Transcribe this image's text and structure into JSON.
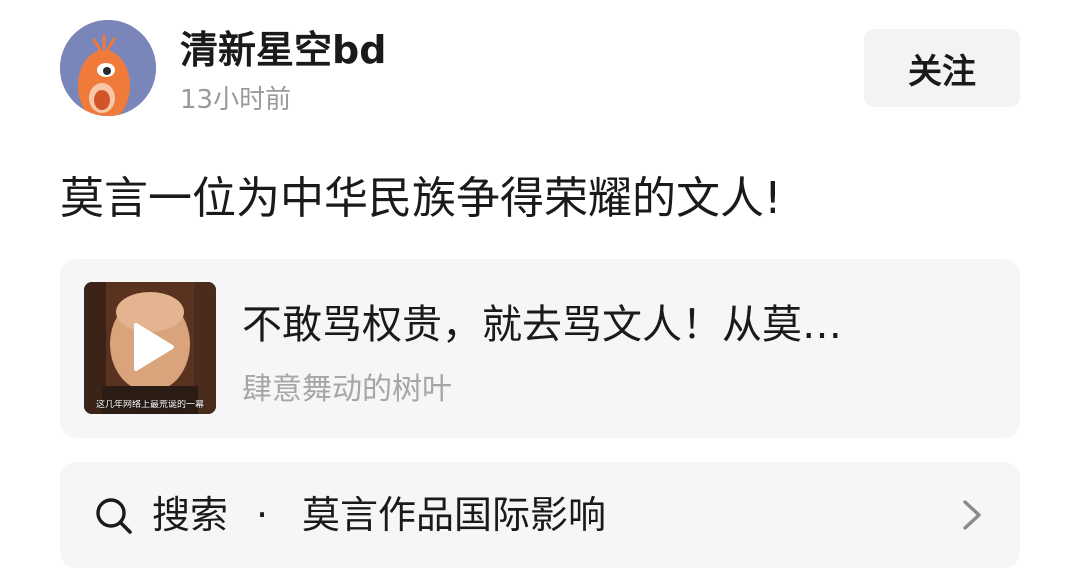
{
  "author": {
    "name": "清新星空bd",
    "time": "13小时前",
    "avatar_icon": "cartoon-creature-avatar",
    "avatar_bg": "#7a86b9"
  },
  "follow_button": {
    "label": "关注"
  },
  "post": {
    "text": "莫言一位为中华民族争得荣耀的文人!"
  },
  "video_card": {
    "title": "不敢骂权贵，就去骂文人！从莫…",
    "author": "肆意舞动的树叶",
    "thumbnail_caption": "这几年网络上最荒诞的一幕",
    "play_icon": "play-icon"
  },
  "search": {
    "icon": "search-icon",
    "label": "搜索",
    "separator": "·",
    "query": "莫言作品国际影响",
    "chevron": "chevron-right-icon"
  },
  "colors": {
    "card_bg": "#f5f6f8",
    "button_bg": "#f2f3f5",
    "primary_text": "#1a1a1a",
    "secondary_text": "#9a9a9a"
  }
}
